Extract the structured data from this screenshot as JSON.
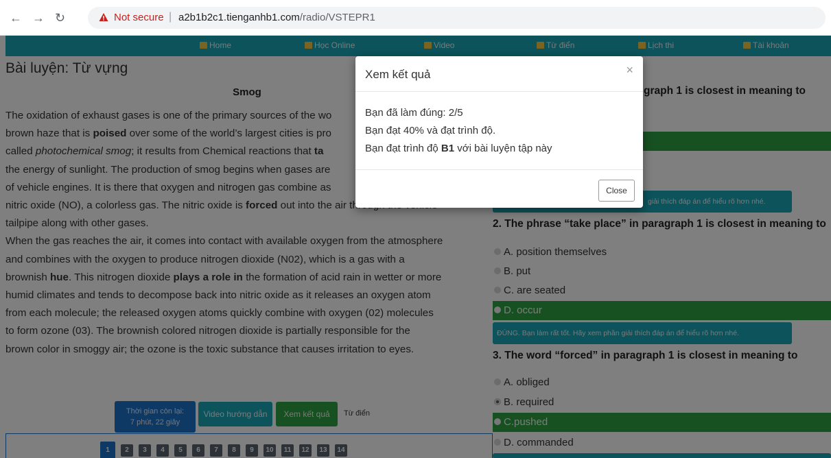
{
  "browser": {
    "security": "Not secure",
    "url_host": "a2b1b2c1.tienganhb1.com",
    "url_path": "/radio/VSTEPR1"
  },
  "nav": [
    {
      "label": "Home",
      "icon": "monitor-icon"
    },
    {
      "label": "Học Online",
      "icon": "home-icon"
    },
    {
      "label": "Video",
      "icon": "video-icon"
    },
    {
      "label": "Từ điển",
      "icon": "book-icon"
    },
    {
      "label": "Lịch thi",
      "icon": "calendar-icon"
    },
    {
      "label": "Tài khoản",
      "icon": "list-icon"
    }
  ],
  "page": {
    "title": "Bài luyện: Từ vựng",
    "article_title": "Smog"
  },
  "passage": {
    "p1a": "The oxidation of exhaust gases is one of the primary sources of the wo",
    "p1b": "brown haze that is ",
    "w_poised": "poised",
    "p1c": " over some of the world’s largest cities is pro",
    "p1d": "called ",
    "w_photo": "photochemical smog",
    "p1e": "; it results from Chemical reactions that ",
    "w_ta": "ta",
    "p1f": "the energy of sunlight. The production of smog begins when gases are",
    "p1g": "of vehicle engines. It is there that oxygen and nitrogen gas combine as",
    "p1h": "nitric oxide (NO), a colorless gas. The nitric oxide is ",
    "w_forced": "forced",
    "p1i": " out into the air through the vehicle",
    "p1j": "tailpipe along with other gases.",
    "p2a": "When the gas reaches the air, it comes into contact with available oxygen from the atmosphere",
    "p2b": "and combines with the oxygen to produce nitrogen dioxide (N02), which is a gas with a",
    "p2c": "brownish ",
    "w_hue": "hue",
    "p2d": ". This nitrogen dioxide ",
    "w_role": "plays a role in",
    "p2e": " the formation of acid rain in wetter or more",
    "p2f": "humid climates and tends to decompose back into nitric oxide as it releases an oxygen atom",
    "p2g": "from each molecule; the released oxygen atoms quickly combine with oxygen (02) molecules",
    "p2h": "to form ozone (03). The brownish colored nitrogen dioxide is partially responsible for the",
    "p2i": "brown color in smoggy air; the ozone is the toxic substance that causes irritation to eyes."
  },
  "controls": {
    "timer_label": "Thời gian còn lại:",
    "timer_value": "7 phút, 22 giây",
    "video_label": "Video hướng dẫn",
    "result_label": "Xem kết quả",
    "dict_label": "Từ điển"
  },
  "pager": [
    "1",
    "2",
    "3",
    "4",
    "5",
    "6",
    "7",
    "8",
    "9",
    "10",
    "11",
    "12",
    "13",
    "14"
  ],
  "questions": {
    "q1_heading_partial": "graph 1 is closest in meaning to",
    "feedback_partial": "giải thích đáp án để hiểu rõ hơn nhé.",
    "q2_heading": "2. The phrase “take place” in paragraph 1 is closest in meaning to",
    "q2_options": [
      "A. position themselves",
      "B. put",
      "C. are seated",
      "D. occur"
    ],
    "q2_feedback": "ĐÚNG. Bạn làm rất tốt. Hãy xem phần giải thích đáp án để hiểu rõ hơn nhé.",
    "q3_heading": "3. The word “forced” in paragraph 1 is closest in meaning to",
    "q3_options": [
      "A. obliged",
      "B. required",
      "C.pushed",
      "D. commanded"
    ]
  },
  "modal": {
    "title": "Xem kết quả",
    "close_x": "×",
    "line1": "Bạn đã làm đúng: 2/5",
    "line2": "Bạn đạt 40% và đạt trình độ.",
    "line3_a": "Bạn đạt trình độ ",
    "line3_level": "B1",
    "line3_b": " với bài luyện tập này",
    "close_label": "Close"
  }
}
